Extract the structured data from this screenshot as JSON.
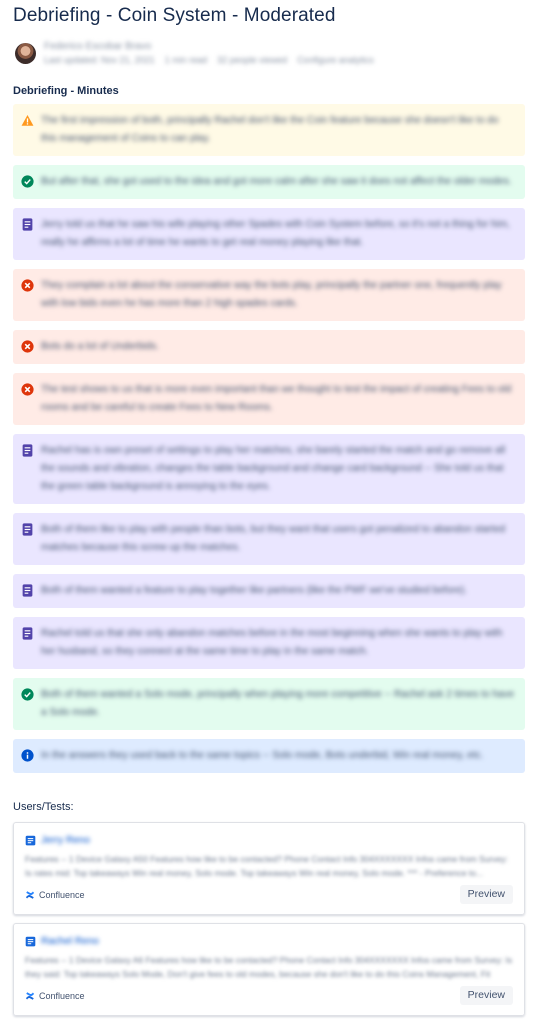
{
  "page": {
    "title": "Debriefing - Coin System - Moderated",
    "author": "Federico Escobar Bravo",
    "meta": [
      "Last updated: Nov 21, 2021",
      "1 min read",
      "32 people viewed",
      "Configure analytics"
    ]
  },
  "minutes": {
    "heading": "Debriefing - Minutes",
    "panels": [
      {
        "type": "warn",
        "icon": "warning-icon",
        "text": "The first impression of both, principally Rachel don't like the Coin feature because she doesn't like to do this management of Coins to can play."
      },
      {
        "type": "success",
        "icon": "check-circle-icon",
        "text": "But after that, she got used to the idea and got more calm after she saw it does not affect the older modes."
      },
      {
        "type": "note",
        "icon": "note-icon",
        "text": "Jerry told us that he saw his wife playing other Spades with Coin System before, so it's not a thing for him, really he affirms a lot of time he wants to get real money playing like that."
      },
      {
        "type": "error",
        "icon": "error-circle-icon",
        "text": "They complain a lot about the conservative way the bots play, principally the partner one, frequently play with low bids even he has more than 2 high spades cards."
      },
      {
        "type": "error",
        "icon": "error-circle-icon",
        "text": "Bots do a lot of Underbids."
      },
      {
        "type": "error",
        "icon": "error-circle-icon",
        "text": "The test shows to us that is more even important than we thought to test the impact of creating Fees to old rooms and be careful to create Fees to New Rooms."
      },
      {
        "type": "note",
        "icon": "note-icon",
        "text": "Rachel has is own preset of settings to play her matches, she barely started the match and go remove all the sounds and vibration, changes the table background and change card background -- She told us that the green table background is annoying to the eyes."
      },
      {
        "type": "note",
        "icon": "note-icon",
        "text": "Both of them like to play with people than bots, but they want that users got penalized to abandon started matches because this screw up the matches."
      },
      {
        "type": "note",
        "icon": "note-icon",
        "text": "Both of them wanted a feature to play together like partners (like the PWF we've studied before)."
      },
      {
        "type": "note",
        "icon": "note-icon",
        "text": "Rachel told us that she only abandon matches before in the most beginning when she wants to play with her husband, so they connect at the same time to play in the same match."
      },
      {
        "type": "success",
        "icon": "check-circle-icon",
        "text": "Both of them wanted a Solo mode, principally when playing more competitive -- Rachel ask 2 times to have a Solo mode."
      },
      {
        "type": "info",
        "icon": "info-icon",
        "text": "In the answers they used back to the same topics -- Solo mode, Bots underbid, Win real money, etc."
      }
    ]
  },
  "users": {
    "heading": "Users/Tests:",
    "cards": [
      {
        "title": "Jerry Reno",
        "description": "Features -- 1 Device Galaxy A50 Features how like to be contacted? Phone Contact Info 304XXXXXXX Infos came from Survey: Is rates mid: Top takeaways Win real money, Solo mode. Top takeaways Win real money, Solo mode. *** - Preference to...",
        "source": "Confluence",
        "action": "Preview"
      },
      {
        "title": "Rachel Reno",
        "description": "Features -- 1 Device Galaxy A6 Features how like to be contacted? Phone Contact Info 304XXXXXXX Infos came from Survey: Is they said: Top takeaways Solo Mode, Don't give fees to old modes, because she don't like to do this Coins Management, Fit you...",
        "source": "Confluence",
        "action": "Preview"
      }
    ]
  },
  "colors": {
    "warn": "#fffae6",
    "success": "#e3fcef",
    "note": "#eae6ff",
    "error": "#ffebe6",
    "info": "#deebff",
    "warn_icon": "#ff991f",
    "success_icon": "#00875a",
    "note_icon": "#5243aa",
    "error_icon": "#de350b",
    "info_icon": "#0052cc"
  }
}
